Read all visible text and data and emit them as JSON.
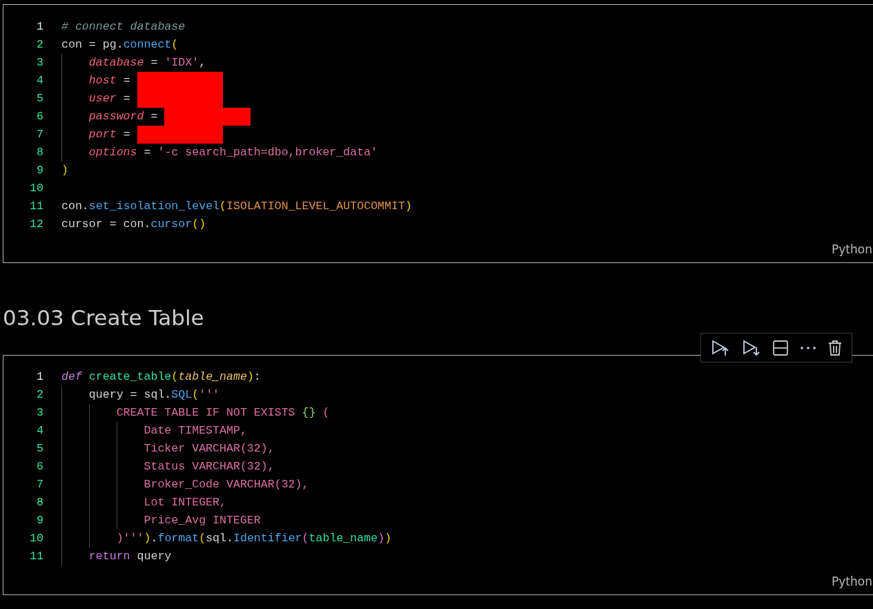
{
  "cells": [
    {
      "language": "Python",
      "lines": [
        {
          "number": "1",
          "active": true,
          "tokens": [
            {
              "kind": "comment",
              "text": "# connect database"
            }
          ]
        },
        {
          "number": "2",
          "active": false,
          "tokens": [
            {
              "kind": "plain",
              "text": "con = pg."
            },
            {
              "kind": "func",
              "text": "connect"
            },
            {
              "kind": "bracket",
              "text": "("
            }
          ]
        },
        {
          "number": "3",
          "active": false,
          "tokens": [
            {
              "kind": "guide"
            },
            {
              "kind": "param",
              "text": "database"
            },
            {
              "kind": "plain",
              "text": " = "
            },
            {
              "kind": "string",
              "text": "'IDX'"
            },
            {
              "kind": "plain",
              "text": ","
            }
          ]
        },
        {
          "number": "4",
          "active": false,
          "tokens": [
            {
              "kind": "guide"
            },
            {
              "kind": "param",
              "text": "host"
            },
            {
              "kind": "plain",
              "text": " = "
            },
            {
              "kind": "redaction"
            }
          ]
        },
        {
          "number": "5",
          "active": false,
          "tokens": [
            {
              "kind": "guide"
            },
            {
              "kind": "param",
              "text": "user"
            },
            {
              "kind": "plain",
              "text": " = "
            },
            {
              "kind": "redaction"
            }
          ]
        },
        {
          "number": "6",
          "active": false,
          "tokens": [
            {
              "kind": "guide"
            },
            {
              "kind": "param",
              "text": "password"
            },
            {
              "kind": "plain",
              "text": " = "
            },
            {
              "kind": "redaction"
            }
          ]
        },
        {
          "number": "7",
          "active": false,
          "tokens": [
            {
              "kind": "guide"
            },
            {
              "kind": "param",
              "text": "port"
            },
            {
              "kind": "plain",
              "text": " = "
            },
            {
              "kind": "redaction"
            }
          ]
        },
        {
          "number": "8",
          "active": false,
          "tokens": [
            {
              "kind": "guide"
            },
            {
              "kind": "param",
              "text": "options"
            },
            {
              "kind": "plain",
              "text": " = "
            },
            {
              "kind": "string",
              "text": "'-c search_path=dbo,broker_data'"
            }
          ]
        },
        {
          "number": "9",
          "active": false,
          "tokens": [
            {
              "kind": "bracket",
              "text": ")"
            }
          ]
        },
        {
          "number": "10",
          "active": false
        },
        {
          "number": "11",
          "active": false,
          "tokens": [
            {
              "kind": "plain",
              "text": "con."
            },
            {
              "kind": "func",
              "text": "set_isolation_level"
            },
            {
              "kind": "bracket",
              "text": "("
            },
            {
              "kind": "constant",
              "text": "ISOLATION_LEVEL_AUTOCOMMIT"
            },
            {
              "kind": "bracket",
              "text": ")"
            }
          ]
        },
        {
          "number": "12",
          "active": false,
          "tokens": [
            {
              "kind": "plain",
              "text": "cursor = con."
            },
            {
              "kind": "func",
              "text": "cursor"
            },
            {
              "kind": "bracket",
              "text": "()"
            }
          ]
        }
      ]
    },
    {
      "heading": "03.03 Create Table"
    },
    {
      "language": "Python",
      "toolbar": true,
      "lines": [
        {
          "number": "1",
          "active": true,
          "tokens": [
            {
              "kind": "keyword",
              "text": "def"
            },
            {
              "kind": "defname",
              "text": "create_table"
            },
            {
              "kind": "bracket",
              "text": "("
            },
            {
              "kind": "argname",
              "text": "table_name"
            },
            {
              "kind": "bracket",
              "text": ")"
            },
            {
              "kind": "plain",
              "text": ":"
            }
          ]
        },
        {
          "number": "2",
          "active": false,
          "tokens": [
            {
              "kind": "guide"
            },
            {
              "kind": "plain",
              "text": "query = sql."
            },
            {
              "kind": "func",
              "text": "SQL"
            },
            {
              "kind": "bracket",
              "text": "("
            },
            {
              "kind": "string",
              "text": "'''"
            }
          ]
        },
        {
          "number": "3",
          "active": false,
          "tokens": [
            {
              "kind": "guide"
            },
            {
              "kind": "guide"
            },
            {
              "kind": "string",
              "text": "CREATE TABLE IF NOT EXISTS "
            },
            {
              "kind": "brace",
              "text": "{}"
            },
            {
              "kind": "string",
              "text": " ("
            }
          ]
        },
        {
          "number": "4",
          "active": false,
          "tokens": [
            {
              "kind": "guide"
            },
            {
              "kind": "guide"
            },
            {
              "kind": "guide"
            },
            {
              "kind": "string",
              "text": "Date TIMESTAMP,"
            }
          ]
        },
        {
          "number": "5",
          "active": false,
          "tokens": [
            {
              "kind": "guide"
            },
            {
              "kind": "guide"
            },
            {
              "kind": "guide"
            },
            {
              "kind": "string",
              "text": "Ticker VARCHAR(32),"
            }
          ]
        },
        {
          "number": "6",
          "active": false,
          "tokens": [
            {
              "kind": "guide"
            },
            {
              "kind": "guide"
            },
            {
              "kind": "guide"
            },
            {
              "kind": "string",
              "text": "Status VARCHAR(32),"
            }
          ]
        },
        {
          "number": "7",
          "active": false,
          "tokens": [
            {
              "kind": "guide"
            },
            {
              "kind": "guide"
            },
            {
              "kind": "guide"
            },
            {
              "kind": "string",
              "text": "Broker_Code VARCHAR(32),"
            }
          ]
        },
        {
          "number": "8",
          "active": false,
          "tokens": [
            {
              "kind": "guide"
            },
            {
              "kind": "guide"
            },
            {
              "kind": "guide"
            },
            {
              "kind": "string",
              "text": "Lot INTEGER,"
            }
          ]
        },
        {
          "number": "9",
          "active": false,
          "tokens": [
            {
              "kind": "guide"
            },
            {
              "kind": "guide"
            },
            {
              "kind": "guide"
            },
            {
              "kind": "string",
              "text": "Price_Avg INTEGER"
            }
          ]
        },
        {
          "number": "10",
          "active": false,
          "tokens": [
            {
              "kind": "guide"
            },
            {
              "kind": "guide"
            },
            {
              "kind": "string",
              "text": ")'''"
            },
            {
              "kind": "bracket",
              "text": ")"
            },
            {
              "kind": "plain",
              "text": "."
            },
            {
              "kind": "func",
              "text": "format"
            },
            {
              "kind": "bracket",
              "text": "("
            },
            {
              "kind": "plain",
              "text": "sql."
            },
            {
              "kind": "func",
              "text": "Identifier"
            },
            {
              "kind": "bracket2",
              "text": "("
            },
            {
              "kind": "variable",
              "text": "table_name"
            },
            {
              "kind": "bracket2",
              "text": ")"
            },
            {
              "kind": "bracket",
              "text": ")"
            }
          ]
        },
        {
          "number": "11",
          "active": false,
          "tokens": [
            {
              "kind": "guide"
            },
            {
              "kind": "control",
              "text": "return"
            },
            {
              "kind": "plain",
              "text": " query"
            }
          ]
        }
      ]
    }
  ]
}
